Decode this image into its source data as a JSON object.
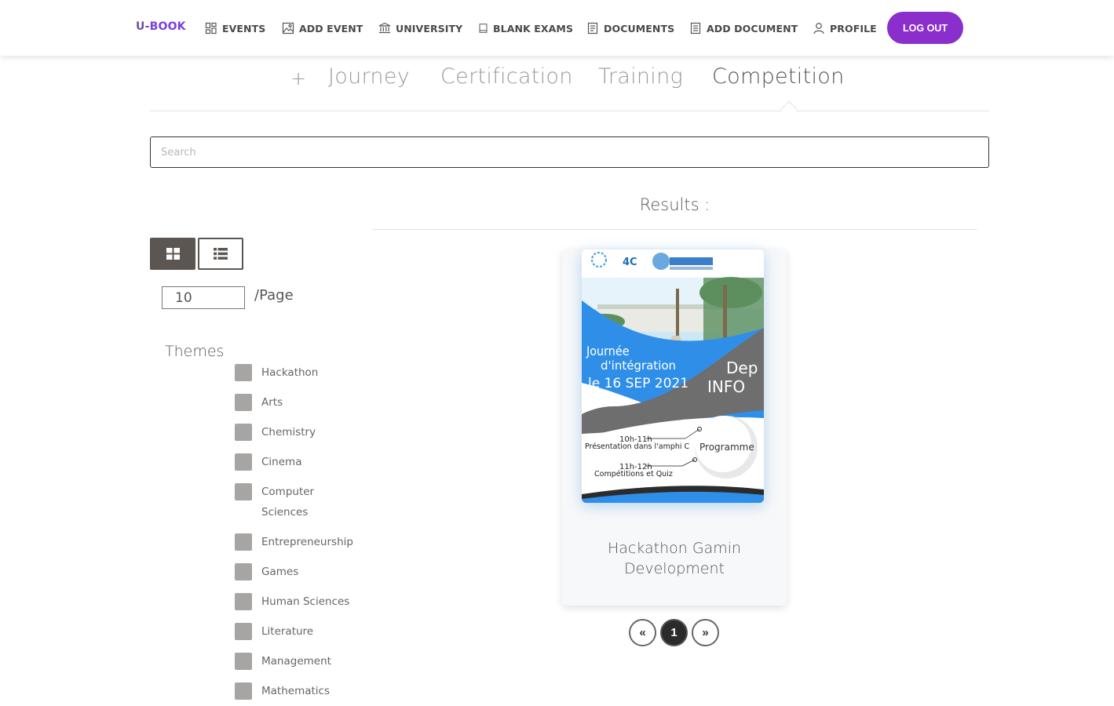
{
  "navbar": {
    "brand_prefix": "U-",
    "brand_name": "BOOK",
    "items": [
      {
        "label": "EVENTS",
        "icon": "events-grid-icon"
      },
      {
        "label": "ADD EVENT",
        "icon": "image-icon"
      },
      {
        "label": "UNIVERSITY",
        "icon": "university-icon"
      },
      {
        "label": "BLANK EXAMS",
        "icon": "book-icon"
      },
      {
        "label": "DOCUMENTS",
        "icon": "document-icon"
      },
      {
        "label": "ADD DOCUMENT",
        "icon": "document-add-icon"
      },
      {
        "label": "PROFILE",
        "icon": "user-icon"
      }
    ],
    "logout_label": "LOG OUT"
  },
  "tabs": {
    "plus": "+",
    "items": [
      "Journey",
      "Certification",
      "Training",
      "Competition"
    ],
    "active": "Competition"
  },
  "search": {
    "placeholder": "Search",
    "value": ""
  },
  "results": {
    "title": "Results :"
  },
  "view": {
    "active": "grid",
    "grid_icon": "grid-view-icon",
    "list_icon": "list-view-icon"
  },
  "per_page": {
    "value": "10",
    "label": "/Page"
  },
  "themes": {
    "title": "Themes",
    "items": [
      "Hackathon",
      "Arts",
      "Chemistry",
      "Cinema",
      "Computer Sciences",
      "Entrepreneurship",
      "Games",
      "Human Sciences",
      "Literature",
      "Management",
      "Mathematics"
    ]
  },
  "card": {
    "title": "Hackathon Gamin Development",
    "poster": {
      "logo_text": "4C",
      "line1": "Journée",
      "line2": "d'intégration",
      "line3": "le 16 SEP 2021",
      "dep": "Dep",
      "info": "INFO",
      "time1": "10h-11h",
      "desc1": "Présentation dans l'amphi C",
      "time2": "11h-12h",
      "desc2": "Compétitions et Quiz",
      "programme": "Programme"
    }
  },
  "pagination": {
    "prev": "«",
    "current": "1",
    "next": "»"
  },
  "colors": {
    "accent": "#8a2fcb",
    "dark_toggle": "#5b5652",
    "poster_blue": "#2f8fe8",
    "poster_gray": "#6e6e6e"
  }
}
